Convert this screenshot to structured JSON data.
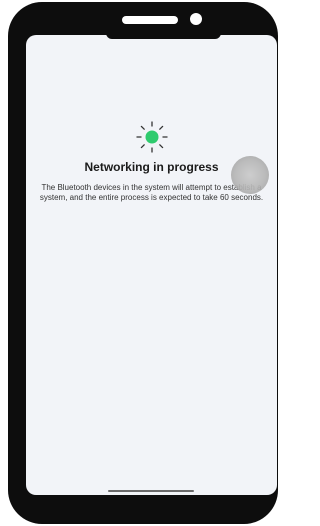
{
  "networking": {
    "title": "Networking in progress",
    "description": "The Bluetooth devices in the system will attempt to establish a system, and the entire process is expected to take 60 seconds."
  },
  "spinner": {
    "icon": "loading-spinner-icon",
    "dot_color": "#2fcb6e",
    "tick_color": "#333333"
  },
  "touch_indicator": {
    "color": "#b5b5b5"
  }
}
